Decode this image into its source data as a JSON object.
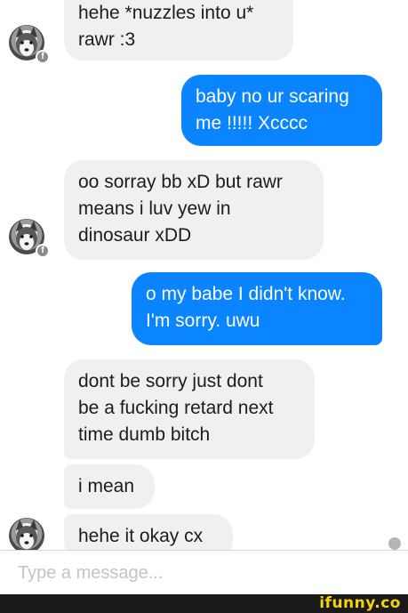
{
  "messages": [
    {
      "from": "them",
      "text": "hehe *nuzzles into u*\nrawr :3"
    },
    {
      "from": "me",
      "text": "baby no ur scaring\nme !!!!! Xcccc"
    },
    {
      "from": "them",
      "text": "oo sorray bb xD but rawr\nmeans i luv yew in\ndinosaur xDD"
    },
    {
      "from": "me",
      "text": "o my babe I didn't know.\nI'm sorry. uwu"
    },
    {
      "from": "them",
      "text": "dont be sorry just dont\nbe a fucking retard next\ntime dumb bitch"
    },
    {
      "from": "them",
      "text": "i mean"
    },
    {
      "from": "them",
      "text": "hehe it okay cx"
    }
  ],
  "input": {
    "placeholder": "Type a message..."
  },
  "watermark": "ifunny.co",
  "colors": {
    "outgoing_bubble": "#0a84ff",
    "incoming_bubble": "#f1f0f0"
  },
  "icons": {
    "avatar": "husky-avatar",
    "badge": "facebook-badge-icon"
  }
}
